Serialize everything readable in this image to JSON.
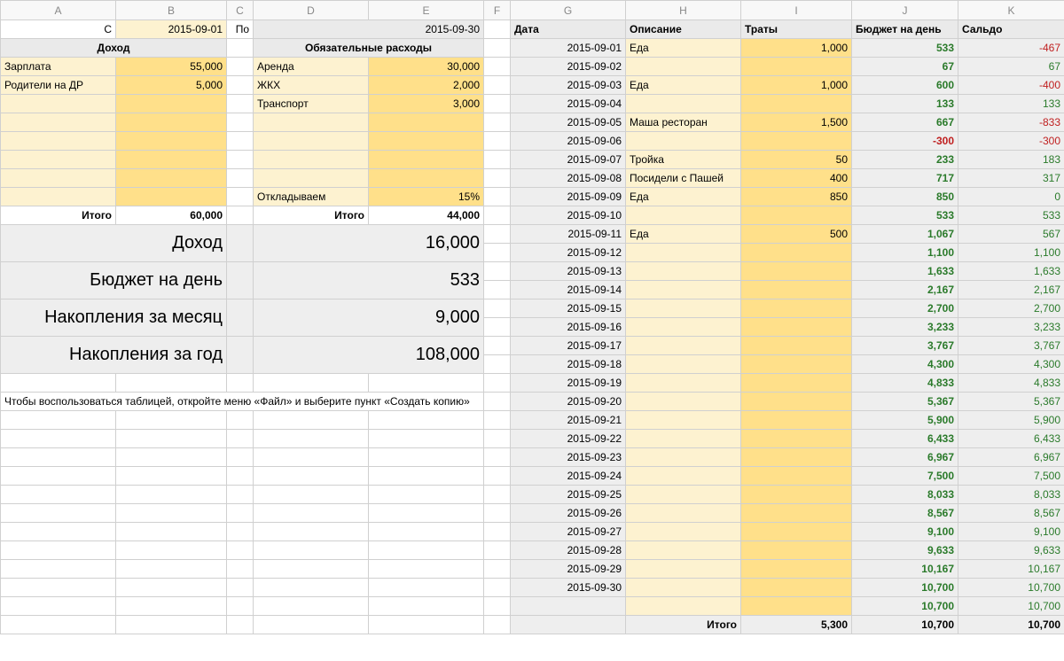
{
  "cols": [
    "A",
    "B",
    "C",
    "D",
    "E",
    "F",
    "G",
    "H",
    "I",
    "J",
    "K"
  ],
  "row1": {
    "A": "С",
    "B": "2015-09-01",
    "C": "По",
    "DE": "2015-09-30",
    "G": "Дата",
    "H": "Описание",
    "I": "Траты",
    "J": "Бюджет на день",
    "K": "Сальдо"
  },
  "row2": {
    "AB": "Доход",
    "DE": "Обязательные расходы"
  },
  "income": [
    {
      "name": "Зарплата",
      "amount": "55,000"
    },
    {
      "name": "Родители на ДР",
      "amount": "5,000"
    },
    {
      "name": "",
      "amount": ""
    },
    {
      "name": "",
      "amount": ""
    },
    {
      "name": "",
      "amount": ""
    },
    {
      "name": "",
      "amount": ""
    },
    {
      "name": "",
      "amount": ""
    },
    {
      "name": "",
      "amount": ""
    }
  ],
  "expenses": [
    {
      "name": "Аренда",
      "amount": "30,000"
    },
    {
      "name": "ЖКХ",
      "amount": "2,000"
    },
    {
      "name": "Транспорт",
      "amount": "3,000"
    },
    {
      "name": "",
      "amount": ""
    },
    {
      "name": "",
      "amount": ""
    },
    {
      "name": "",
      "amount": ""
    },
    {
      "name": "",
      "amount": ""
    },
    {
      "name": "Откладываем",
      "amount": "15%"
    }
  ],
  "totals_left": {
    "itogo_label": "Итого",
    "income_total": "60,000",
    "expense_total": "44,000"
  },
  "summary": [
    {
      "label": "Доход",
      "value": "16,000"
    },
    {
      "label": "Бюджет на день",
      "value": "533"
    },
    {
      "label": "Накопления за месяц",
      "value": "9,000"
    },
    {
      "label": "Накопления за год",
      "value": "108,000"
    }
  ],
  "note": "Чтобы воспользоваться таблицей, откройте меню «Файл» и выберите пункт «Создать копию»",
  "daily": [
    {
      "date": "2015-09-01",
      "desc": "Еда",
      "spend": "1,000",
      "budget": "533",
      "budget_red": false,
      "saldo": "-467",
      "saldo_neg": true
    },
    {
      "date": "2015-09-02",
      "desc": "",
      "spend": "",
      "budget": "67",
      "budget_red": false,
      "saldo": "67",
      "saldo_neg": false
    },
    {
      "date": "2015-09-03",
      "desc": "Еда",
      "spend": "1,000",
      "budget": "600",
      "budget_red": false,
      "saldo": "-400",
      "saldo_neg": true
    },
    {
      "date": "2015-09-04",
      "desc": "",
      "spend": "",
      "budget": "133",
      "budget_red": false,
      "saldo": "133",
      "saldo_neg": false
    },
    {
      "date": "2015-09-05",
      "desc": "Маша ресторан",
      "spend": "1,500",
      "budget": "667",
      "budget_red": false,
      "saldo": "-833",
      "saldo_neg": true
    },
    {
      "date": "2015-09-06",
      "desc": "",
      "spend": "",
      "budget": "-300",
      "budget_red": true,
      "saldo": "-300",
      "saldo_neg": true
    },
    {
      "date": "2015-09-07",
      "desc": "Тройка",
      "spend": "50",
      "budget": "233",
      "budget_red": false,
      "saldo": "183",
      "saldo_neg": false
    },
    {
      "date": "2015-09-08",
      "desc": "Посидели с Пашей",
      "spend": "400",
      "budget": "717",
      "budget_red": false,
      "saldo": "317",
      "saldo_neg": false
    },
    {
      "date": "2015-09-09",
      "desc": "Еда",
      "spend": "850",
      "budget": "850",
      "budget_red": false,
      "saldo": "0",
      "saldo_neg": false
    },
    {
      "date": "2015-09-10",
      "desc": "",
      "spend": "",
      "budget": "533",
      "budget_red": false,
      "saldo": "533",
      "saldo_neg": false
    },
    {
      "date": "2015-09-11",
      "desc": "Еда",
      "spend": "500",
      "budget": "1,067",
      "budget_red": false,
      "saldo": "567",
      "saldo_neg": false
    },
    {
      "date": "2015-09-12",
      "desc": "",
      "spend": "",
      "budget": "1,100",
      "budget_red": false,
      "saldo": "1,100",
      "saldo_neg": false
    },
    {
      "date": "2015-09-13",
      "desc": "",
      "spend": "",
      "budget": "1,633",
      "budget_red": false,
      "saldo": "1,633",
      "saldo_neg": false
    },
    {
      "date": "2015-09-14",
      "desc": "",
      "spend": "",
      "budget": "2,167",
      "budget_red": false,
      "saldo": "2,167",
      "saldo_neg": false
    },
    {
      "date": "2015-09-15",
      "desc": "",
      "spend": "",
      "budget": "2,700",
      "budget_red": false,
      "saldo": "2,700",
      "saldo_neg": false
    },
    {
      "date": "2015-09-16",
      "desc": "",
      "spend": "",
      "budget": "3,233",
      "budget_red": false,
      "saldo": "3,233",
      "saldo_neg": false
    },
    {
      "date": "2015-09-17",
      "desc": "",
      "spend": "",
      "budget": "3,767",
      "budget_red": false,
      "saldo": "3,767",
      "saldo_neg": false
    },
    {
      "date": "2015-09-18",
      "desc": "",
      "spend": "",
      "budget": "4,300",
      "budget_red": false,
      "saldo": "4,300",
      "saldo_neg": false
    },
    {
      "date": "2015-09-19",
      "desc": "",
      "spend": "",
      "budget": "4,833",
      "budget_red": false,
      "saldo": "4,833",
      "saldo_neg": false
    },
    {
      "date": "2015-09-20",
      "desc": "",
      "spend": "",
      "budget": "5,367",
      "budget_red": false,
      "saldo": "5,367",
      "saldo_neg": false
    },
    {
      "date": "2015-09-21",
      "desc": "",
      "spend": "",
      "budget": "5,900",
      "budget_red": false,
      "saldo": "5,900",
      "saldo_neg": false
    },
    {
      "date": "2015-09-22",
      "desc": "",
      "spend": "",
      "budget": "6,433",
      "budget_red": false,
      "saldo": "6,433",
      "saldo_neg": false
    },
    {
      "date": "2015-09-23",
      "desc": "",
      "spend": "",
      "budget": "6,967",
      "budget_red": false,
      "saldo": "6,967",
      "saldo_neg": false
    },
    {
      "date": "2015-09-24",
      "desc": "",
      "spend": "",
      "budget": "7,500",
      "budget_red": false,
      "saldo": "7,500",
      "saldo_neg": false
    },
    {
      "date": "2015-09-25",
      "desc": "",
      "spend": "",
      "budget": "8,033",
      "budget_red": false,
      "saldo": "8,033",
      "saldo_neg": false
    },
    {
      "date": "2015-09-26",
      "desc": "",
      "spend": "",
      "budget": "8,567",
      "budget_red": false,
      "saldo": "8,567",
      "saldo_neg": false
    },
    {
      "date": "2015-09-27",
      "desc": "",
      "spend": "",
      "budget": "9,100",
      "budget_red": false,
      "saldo": "9,100",
      "saldo_neg": false
    },
    {
      "date": "2015-09-28",
      "desc": "",
      "spend": "",
      "budget": "9,633",
      "budget_red": false,
      "saldo": "9,633",
      "saldo_neg": false
    },
    {
      "date": "2015-09-29",
      "desc": "",
      "spend": "",
      "budget": "10,167",
      "budget_red": false,
      "saldo": "10,167",
      "saldo_neg": false
    },
    {
      "date": "2015-09-30",
      "desc": "",
      "spend": "",
      "budget": "10,700",
      "budget_red": false,
      "saldo": "10,700",
      "saldo_neg": false
    },
    {
      "date": "",
      "desc": "",
      "spend": "",
      "budget": "10,700",
      "budget_red": false,
      "saldo": "10,700",
      "saldo_neg": false
    }
  ],
  "totals_right": {
    "label": "Итого",
    "spend": "5,300",
    "budget": "10,700",
    "saldo": "10,700"
  }
}
